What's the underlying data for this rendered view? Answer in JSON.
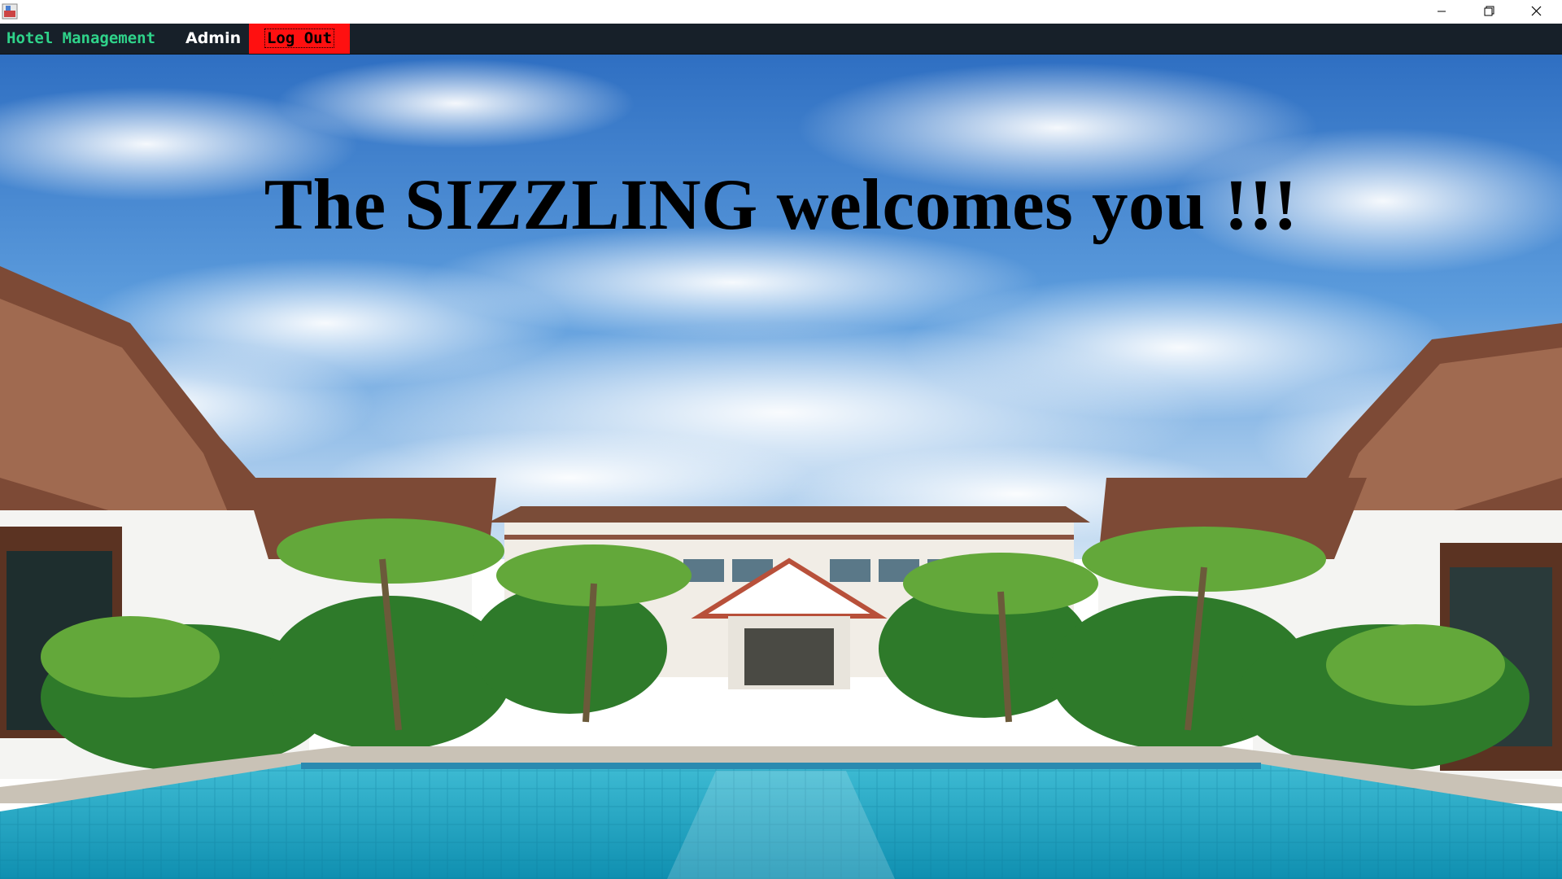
{
  "window": {
    "minimize_icon": "minimize-icon",
    "maximize_icon": "restore-icon",
    "close_icon": "close-icon",
    "app_icon": "java-app-icon"
  },
  "menubar": {
    "hotel_management": "Hotel Management",
    "admin": "Admin",
    "log_out": "Log Out"
  },
  "main": {
    "welcome_text": "The SIZZLING welcomes you !!!",
    "background": "resort-pool-photo"
  },
  "colors": {
    "menubar_bg": "#172029",
    "hotel_menu_text": "#2fd38a",
    "logout_bg": "#ff1010",
    "sky": "#3a7fd0",
    "pool": "#1aa6c4"
  }
}
